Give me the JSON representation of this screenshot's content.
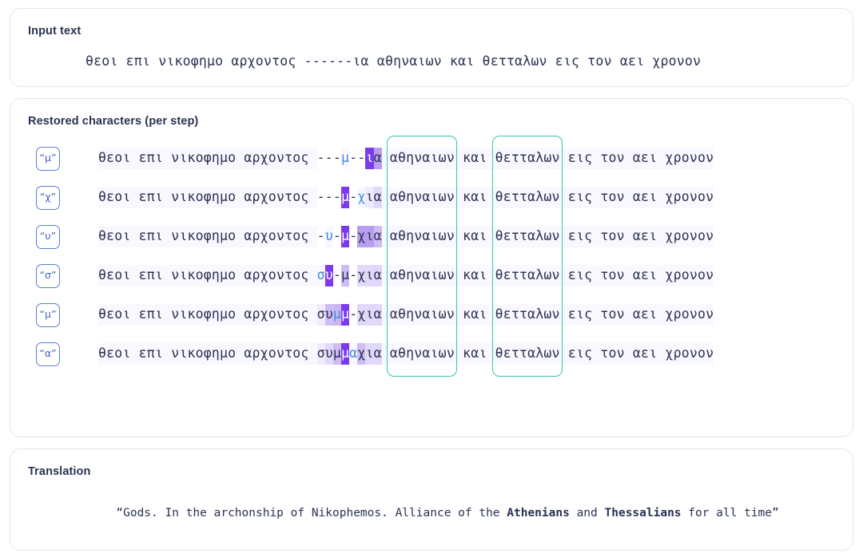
{
  "input_card": {
    "label": "Input text",
    "text": "θεοι επι νικοφημο αρχοντος ------ια αθηναιων και θετταλων εις τον αει χρονον"
  },
  "steps_card": {
    "label": "Restored characters (per step)",
    "group_boxes": [
      {
        "word": "αθηναιων",
        "color": "#34c6b4"
      },
      {
        "word": "θετταλων",
        "color": "#34c6b4"
      }
    ],
    "prefix": "θεοι επι νικοφημο αρχοντος ",
    "suffix": " αθηναιων και θετταλων εις τον αει χρονον",
    "steps": [
      {
        "badge": "“μ”",
        "predicted_char": "μ",
        "gap": "---μ--ια",
        "full_text": "θεοι επι νικοφημο αρχοντος ---μ--ια αθηναιων και θετταλων εις τον αει χρονον",
        "tokens": [
          {
            "t": "-",
            "s": "dash"
          },
          {
            "t": "-",
            "s": "dash"
          },
          {
            "t": "-",
            "s": "dash"
          },
          {
            "t": "μ",
            "s": "new"
          },
          {
            "t": "-",
            "s": "dash"
          },
          {
            "t": "-",
            "s": "dash"
          },
          {
            "t": "ι",
            "s": "hl1"
          },
          {
            "t": "α",
            "s": "hl2"
          }
        ]
      },
      {
        "badge": "“χ”",
        "predicted_char": "χ",
        "gap": "---μ-χια",
        "full_text": "θεοι επι νικοφημο αρχοντος ---μ-χια αθηναιων και θετταλων εις τον αει χρονον",
        "tokens": [
          {
            "t": "-",
            "s": "dash"
          },
          {
            "t": "-",
            "s": "dash"
          },
          {
            "t": "-",
            "s": "dash"
          },
          {
            "t": "μ",
            "s": "hl1"
          },
          {
            "t": "-",
            "s": "dash"
          },
          {
            "t": "χ",
            "s": "new"
          },
          {
            "t": "ι",
            "s": "hl5"
          },
          {
            "t": "α",
            "s": "hl4"
          }
        ]
      },
      {
        "badge": "“υ”",
        "predicted_char": "υ",
        "gap": "-υ-μ-χια",
        "full_text": "θεοι επι νικοφημο αρχοντος -υ-μ-χια αθηναιων και θετταλων εις τον αει χρονον",
        "tokens": [
          {
            "t": "-",
            "s": "dash"
          },
          {
            "t": "υ",
            "s": "new"
          },
          {
            "t": "-",
            "s": "dash"
          },
          {
            "t": "μ",
            "s": "hl1"
          },
          {
            "t": "-",
            "s": "dash"
          },
          {
            "t": "χ",
            "s": "hl2"
          },
          {
            "t": "ι",
            "s": "hl2"
          },
          {
            "t": "α",
            "s": "hl3"
          }
        ]
      },
      {
        "badge": "“σ”",
        "predicted_char": "σ",
        "gap": "συ-μ-χια",
        "full_text": "θεοι επι νικοφημο αρχοντος συ-μ-χια αθηναιων και θετταλων εις τον αει χρονον",
        "tokens": [
          {
            "t": "σ",
            "s": "new"
          },
          {
            "t": "υ",
            "s": "hl1"
          },
          {
            "t": "-",
            "s": "dash"
          },
          {
            "t": "μ",
            "s": "hl3"
          },
          {
            "t": "-",
            "s": "dash"
          },
          {
            "t": "χ",
            "s": "hl4"
          },
          {
            "t": "ι",
            "s": "hl4"
          },
          {
            "t": "α",
            "s": "hl4"
          }
        ]
      },
      {
        "badge": "“μ”",
        "predicted_char": "μ",
        "gap": "συμμ-χια",
        "full_text": "θεοι επι νικοφημο αρχοντος συμμ-χια αθηναιων και θετταλων εις τον αει χρονον",
        "tokens": [
          {
            "t": "σ",
            "s": "hl5"
          },
          {
            "t": "υ",
            "s": "hl3"
          },
          {
            "t": "μ",
            "s": "newhl"
          },
          {
            "t": "μ",
            "s": "hl1"
          },
          {
            "t": "-",
            "s": "dash"
          },
          {
            "t": "χ",
            "s": "hl4"
          },
          {
            "t": "ι",
            "s": "hl4"
          },
          {
            "t": "α",
            "s": "hl4"
          }
        ]
      },
      {
        "badge": "“α”",
        "predicted_char": "α",
        "gap": "συμμαχια",
        "full_text": "θεοι επι νικοφημο αρχοντος συμμαχια αθηναιων και θετταλων εις τον αει χρονον",
        "tokens": [
          {
            "t": "σ",
            "s": "hl5"
          },
          {
            "t": "υ",
            "s": "hl4"
          },
          {
            "t": "μ",
            "s": "hl3"
          },
          {
            "t": "μ",
            "s": "hl1"
          },
          {
            "t": "α",
            "s": "new"
          },
          {
            "t": "χ",
            "s": "hl3"
          },
          {
            "t": "ι",
            "s": "hl4"
          },
          {
            "t": "α",
            "s": "hl4"
          }
        ]
      }
    ]
  },
  "translation_card": {
    "label": "Translation",
    "open_quote": "“Gods. In the archonship of Nikophemos. Alliance of the ",
    "bold_1": "Athenians",
    "mid": " and ",
    "bold_2": "Thessalians",
    "tail": " for all time”",
    "full_text": "“Gods. In the archonship of Nikophemos. Alliance of the Athenians and Thessalians for all time”"
  }
}
